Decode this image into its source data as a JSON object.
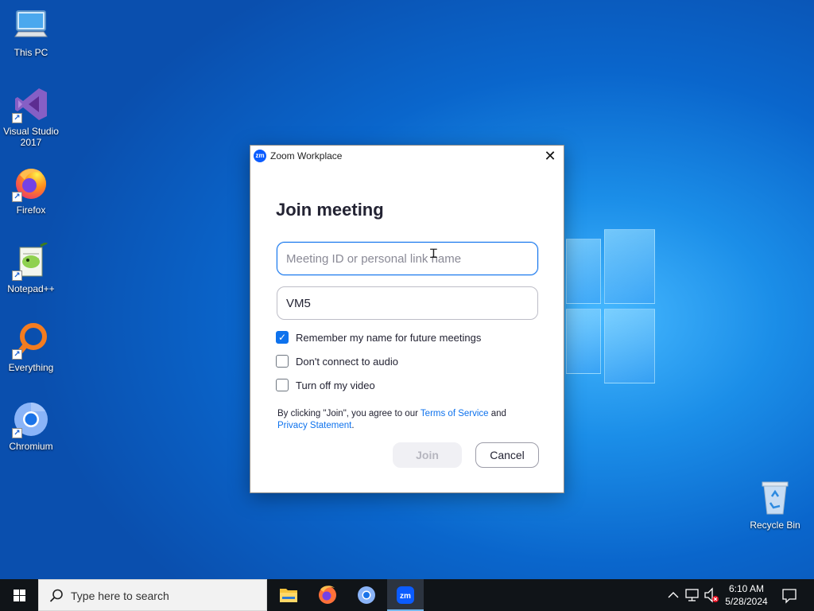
{
  "desktop": {
    "icons": [
      {
        "label": "This PC",
        "icon": "computer-icon"
      },
      {
        "label": "Visual Studio 2017",
        "icon": "visual-studio-icon"
      },
      {
        "label": "Firefox",
        "icon": "firefox-icon"
      },
      {
        "label": "Notepad++",
        "icon": "notepad-plus-plus-icon"
      },
      {
        "label": "Everything",
        "icon": "everything-search-icon"
      },
      {
        "label": "Chromium",
        "icon": "chromium-icon"
      },
      {
        "label": "Recycle Bin",
        "icon": "recycle-bin-icon"
      }
    ]
  },
  "dialog": {
    "app_logo_text": "zm",
    "title": "Zoom Workplace",
    "close_glyph": "✕",
    "heading": "Join meeting",
    "meeting_id": {
      "value": "",
      "placeholder": "Meeting ID or personal link name"
    },
    "name_field": {
      "value": "VM5"
    },
    "options": [
      {
        "label": "Remember my name for future meetings",
        "checked": true
      },
      {
        "label": "Don't connect to audio",
        "checked": false
      },
      {
        "label": "Turn off my video",
        "checked": false
      }
    ],
    "legal": {
      "prefix": "By clicking \"Join\", you agree to our ",
      "terms_link": "Terms of Service",
      "middle": " and",
      "privacy_link": "Privacy Statement",
      "suffix": "."
    },
    "join_label": "Join",
    "cancel_label": "Cancel"
  },
  "taskbar": {
    "search_placeholder": "Type here to search",
    "pinned": [
      {
        "name": "File Explorer",
        "icon": "folder-icon",
        "active": false
      },
      {
        "name": "Firefox",
        "icon": "firefox-icon",
        "active": false
      },
      {
        "name": "Chromium",
        "icon": "chromium-icon",
        "active": false
      },
      {
        "name": "Zoom",
        "icon": "zoom-icon",
        "active": true
      }
    ],
    "tray": {
      "time": "6:10 AM",
      "date": "5/28/2024"
    }
  },
  "colors": {
    "accent": "#0e72ed",
    "zoom_brand": "#0b5cff",
    "taskbar": "#101418"
  }
}
